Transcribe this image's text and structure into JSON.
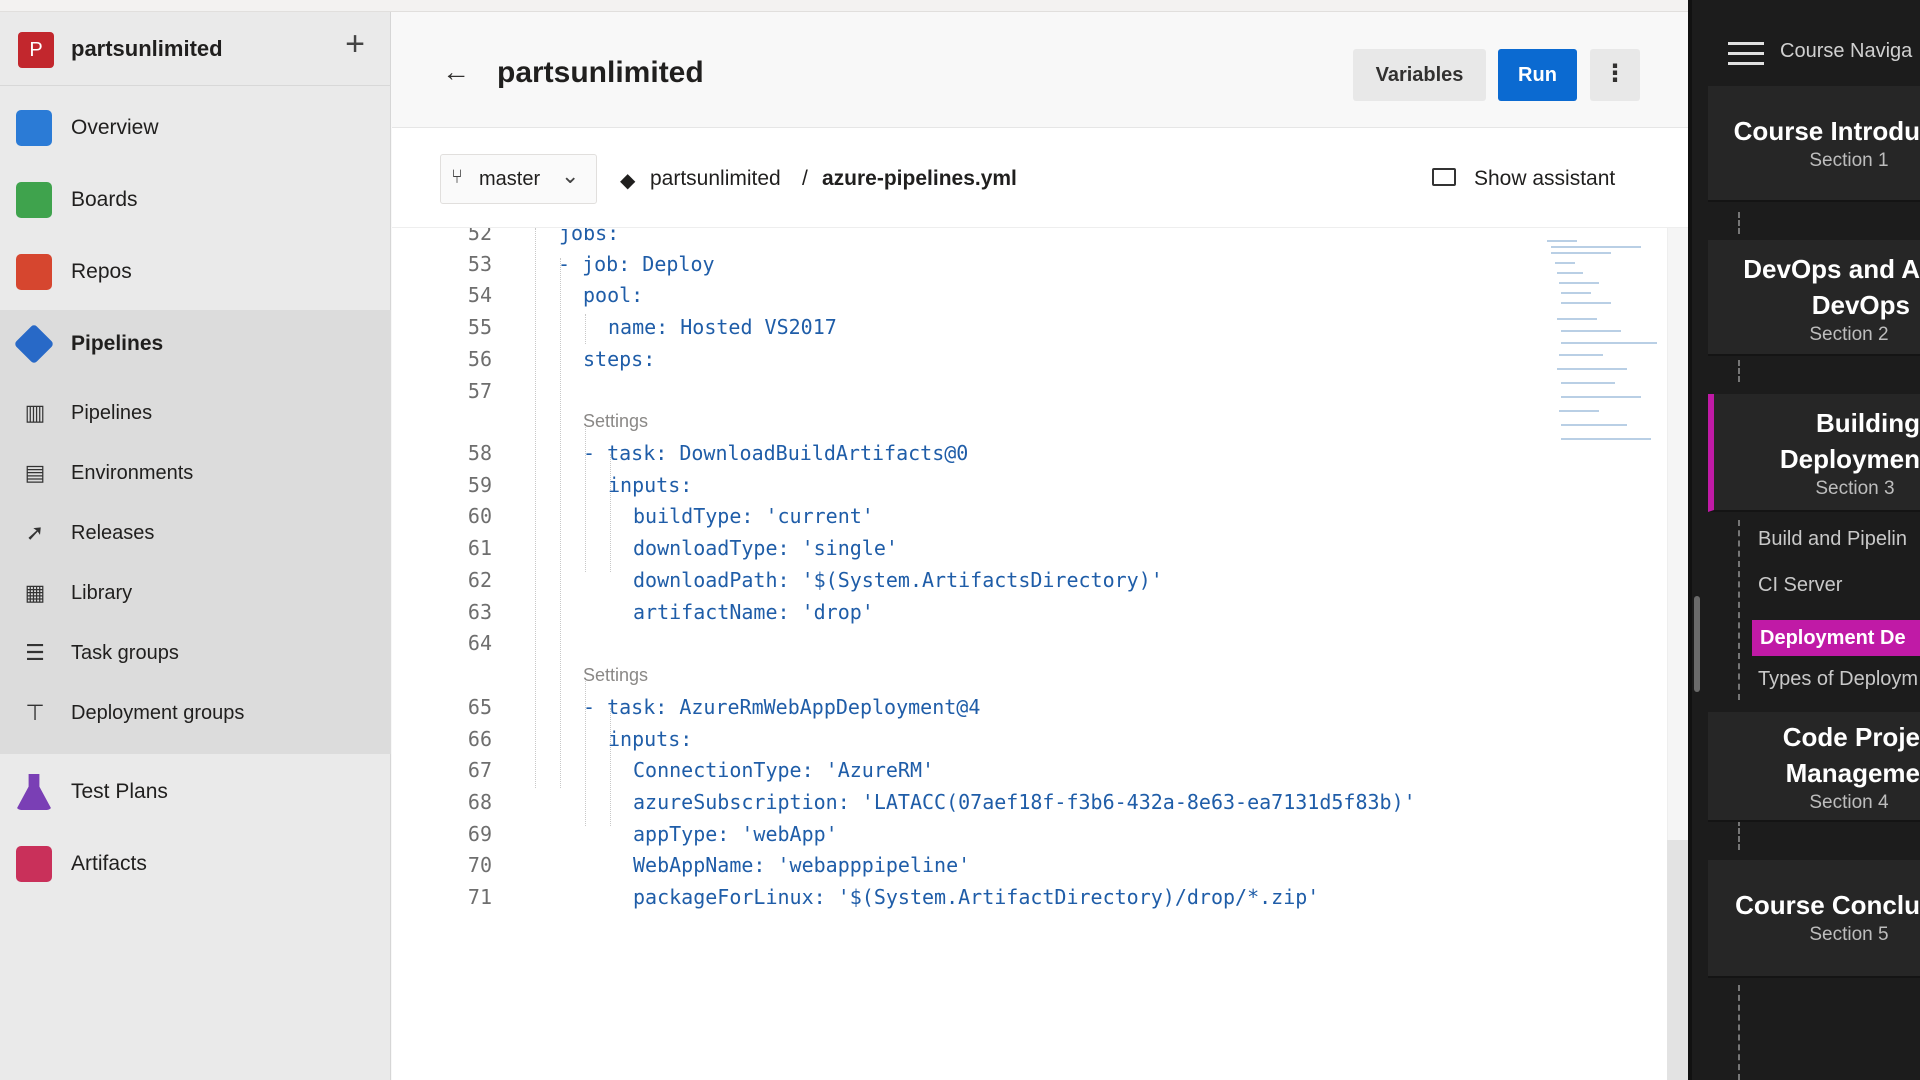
{
  "org": {
    "avatar": "P",
    "name": "partsunlimited",
    "add": "+"
  },
  "nav": {
    "items": [
      {
        "label": "Overview"
      },
      {
        "label": "Boards"
      },
      {
        "label": "Repos"
      },
      {
        "label": "Pipelines"
      },
      {
        "label": "Test Plans"
      },
      {
        "label": "Artifacts"
      }
    ],
    "pipelines_sub": [
      {
        "label": "Pipelines"
      },
      {
        "label": "Environments"
      },
      {
        "label": "Releases"
      },
      {
        "label": "Library"
      },
      {
        "label": "Task groups"
      },
      {
        "label": "Deployment groups"
      }
    ]
  },
  "header": {
    "back": "←",
    "title": "partsunlimited",
    "variables": "Variables",
    "run": "Run",
    "more": "⋮"
  },
  "subbar": {
    "branch": "master",
    "repo": "partsunlimited",
    "sep": "/",
    "file": "azure-pipelines.yml",
    "assistant": "Show assistant"
  },
  "editor": {
    "settings_label": "Settings",
    "lines": [
      {
        "n": "52",
        "t": "jobs:"
      },
      {
        "n": "53",
        "t": "- job: Deploy"
      },
      {
        "n": "54",
        "t": "pool:"
      },
      {
        "n": "55",
        "t": "name: Hosted VS2017"
      },
      {
        "n": "56",
        "t": "steps:"
      },
      {
        "n": "57",
        "t": ""
      },
      {
        "n": "58",
        "t": "- task: DownloadBuildArtifacts@0"
      },
      {
        "n": "59",
        "t": "inputs:"
      },
      {
        "n": "60",
        "t": "buildType: 'current'"
      },
      {
        "n": "61",
        "t": "downloadType: 'single'"
      },
      {
        "n": "62",
        "t": "downloadPath: '$(System.ArtifactsDirectory)'"
      },
      {
        "n": "63",
        "t": "artifactName: 'drop'"
      },
      {
        "n": "64",
        "t": ""
      },
      {
        "n": "65",
        "t": "- task: AzureRmWebAppDeployment@4"
      },
      {
        "n": "66",
        "t": "inputs:"
      },
      {
        "n": "67",
        "t": "ConnectionType: 'AzureRM'"
      },
      {
        "n": "68",
        "t": "azureSubscription: 'LATACC(07aef18f-f3b6-432a-8e63-ea7131d5f83b)'"
      },
      {
        "n": "69",
        "t": "appType: 'webApp'"
      },
      {
        "n": "70",
        "t": "WebAppName: 'webapppipeline'"
      },
      {
        "n": "71",
        "t": "packageForLinux: '$(System.ArtifactDirectory)/drop/*.zip'"
      }
    ]
  },
  "course": {
    "nav_title": "Course Naviga",
    "cards": [
      {
        "title": "Course Introdu",
        "section": "Section 1"
      },
      {
        "title": "DevOps and A",
        "title2": "DevOps",
        "section": "Section 2"
      },
      {
        "title": "Building",
        "title2": "Deploymen",
        "section": "Section 3"
      },
      {
        "title": "Code Proje",
        "title2": "Manageme",
        "section": "Section 4"
      },
      {
        "title": "Course Conclu",
        "section": "Section 5"
      }
    ],
    "lessons": [
      {
        "label": "Build and Pipelin"
      },
      {
        "label": "CI Server"
      },
      {
        "label": "Deployment De"
      },
      {
        "label": "Types of Deploym"
      }
    ]
  },
  "colors": {
    "accent": "#0b6ad1",
    "course_active": "#c01aa6"
  }
}
